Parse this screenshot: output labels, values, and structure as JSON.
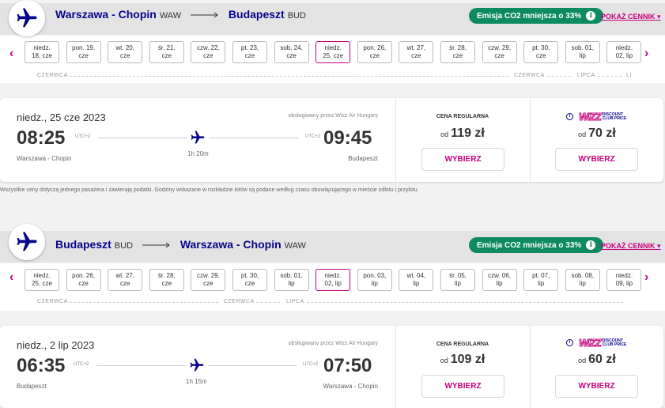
{
  "outbound": {
    "from_city": "Warszawa - Chopin",
    "from_code": "WAW",
    "to_city": "Budapeszt",
    "to_code": "BUD",
    "co2_label": "Emisja CO2 mniejsza o 33%",
    "show_prices": "POKAŻ CENNIK",
    "dates": [
      {
        "day": "niedz.",
        "date": "18, cze"
      },
      {
        "day": "pon. 19,",
        "date": "cze"
      },
      {
        "day": "wt. 20,",
        "date": "cze"
      },
      {
        "day": "śr. 21,",
        "date": "cze"
      },
      {
        "day": "czw. 22,",
        "date": "cze"
      },
      {
        "day": "pt. 23,",
        "date": "cze"
      },
      {
        "day": "sob. 24,",
        "date": "cze"
      },
      {
        "day": "niedz.",
        "date": "25, cze"
      },
      {
        "day": "pon. 26,",
        "date": "cze"
      },
      {
        "day": "wt. 27,",
        "date": "cze"
      },
      {
        "day": "śr. 28,",
        "date": "cze"
      },
      {
        "day": "czw. 29,",
        "date": "cze"
      },
      {
        "day": "pt. 30,",
        "date": "cze"
      },
      {
        "day": "sob. 01,",
        "date": "lip"
      },
      {
        "day": "niedz.",
        "date": "02, lip"
      }
    ],
    "months": [
      "CZERWCA",
      "CZERWCA",
      "LIPCA",
      "LI"
    ],
    "flight": {
      "date": "niedz., 25 cze 2023",
      "operated_by": "obsługiwany przez Wizz Air Hungary",
      "dep_time": "08:25",
      "dep_utc": "UTC+2",
      "arr_time": "09:45",
      "arr_utc": "UTC+2",
      "duration": "1h 20m",
      "dep_city": "Warszawa - Chopin",
      "arr_city": "Budapeszt",
      "regular_label": "CENA REGULARNA",
      "od": "od",
      "regular_price": "119 zł",
      "club_price": "70 zł",
      "select": "WYBIERZ"
    }
  },
  "footnote": "Wszystkie ceny dotyczą jednego pasażera i zawierają podatki. Godziny wskazane w rozkładzie lotów są podane według czasu obowiązującego w mieście odlotu i przylotu.",
  "club": {
    "brand": "WIZZ",
    "line1": "DISCOUNT",
    "line2": "CLUB PRICE"
  },
  "inbound": {
    "from_city": "Budapeszt",
    "from_code": "BUD",
    "to_city": "Warszawa - Chopin",
    "to_code": "WAW",
    "co2_label": "Emisja CO2 mniejsza o 33%",
    "show_prices": "POKAŻ CENNIK",
    "dates": [
      {
        "day": "niedz.",
        "date": "25, cze"
      },
      {
        "day": "pon. 26,",
        "date": "cze"
      },
      {
        "day": "wt. 27,",
        "date": "cze"
      },
      {
        "day": "śr. 28,",
        "date": "cze"
      },
      {
        "day": "czw. 29,",
        "date": "cze"
      },
      {
        "day": "pt. 30,",
        "date": "cze"
      },
      {
        "day": "sob. 01,",
        "date": "lip"
      },
      {
        "day": "niedz.",
        "date": "02, lip"
      },
      {
        "day": "pon. 03,",
        "date": "lip"
      },
      {
        "day": "wt. 04,",
        "date": "lip"
      },
      {
        "day": "śr. 05,",
        "date": "lip"
      },
      {
        "day": "czw. 06,",
        "date": "lip"
      },
      {
        "day": "pt. 07,",
        "date": "lip"
      },
      {
        "day": "sob. 08,",
        "date": "lip"
      },
      {
        "day": "niedz.",
        "date": "09, lip"
      }
    ],
    "months": [
      "CZERWCA",
      "CZERWCA",
      "LIPCA"
    ],
    "flight": {
      "date": "niedz., 2 lip 2023",
      "operated_by": "obsługiwany przez Wizz Air Hungary",
      "dep_time": "06:35",
      "dep_utc": "UTC+2",
      "arr_time": "07:50",
      "arr_utc": "UTC+2",
      "duration": "1h 15m",
      "dep_city": "Budapeszt",
      "arr_city": "Warszawa - Chopin",
      "regular_label": "CENA REGULARNA",
      "od": "od",
      "regular_price": "109 zł",
      "club_price": "60 zł",
      "select": "WYBIERZ"
    }
  },
  "colors": {
    "brand_navy": "#06038d",
    "brand_pink": "#c6007e",
    "co2_green": "#0d8a5f"
  }
}
